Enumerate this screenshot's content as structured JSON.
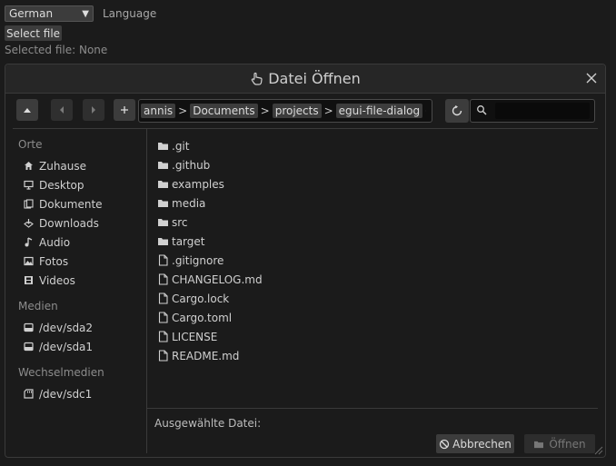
{
  "app": {
    "language_value": "German",
    "language_label": "Language",
    "select_file_label": "Select file",
    "selected_file_text": "Selected file: None"
  },
  "dialog": {
    "title": "Datei Öffnen",
    "path": [
      "annis",
      "Documents",
      "projects",
      "egui-file-dialog"
    ],
    "path_separator": ">",
    "search": {
      "value": "",
      "placeholder": ""
    },
    "sidebar": [
      {
        "heading": "Orte",
        "items": [
          {
            "label": "Zuhause",
            "icon": "home-icon"
          },
          {
            "label": "Desktop",
            "icon": "desktop-icon"
          },
          {
            "label": "Dokumente",
            "icon": "documents-icon"
          },
          {
            "label": "Downloads",
            "icon": "downloads-icon"
          },
          {
            "label": "Audio",
            "icon": "music-icon"
          },
          {
            "label": "Fotos",
            "icon": "image-icon"
          },
          {
            "label": "Videos",
            "icon": "film-icon"
          }
        ]
      },
      {
        "heading": "Medien",
        "items": [
          {
            "label": "/dev/sda2",
            "icon": "disk-icon"
          },
          {
            "label": "/dev/sda1",
            "icon": "disk-icon"
          }
        ]
      },
      {
        "heading": "Wechselmedien",
        "items": [
          {
            "label": "/dev/sdc1",
            "icon": "removable-drive-icon"
          }
        ]
      }
    ],
    "files": [
      {
        "name": ".git",
        "type": "folder"
      },
      {
        "name": ".github",
        "type": "folder"
      },
      {
        "name": "examples",
        "type": "folder"
      },
      {
        "name": "media",
        "type": "folder"
      },
      {
        "name": "src",
        "type": "folder"
      },
      {
        "name": "target",
        "type": "folder"
      },
      {
        "name": ".gitignore",
        "type": "file"
      },
      {
        "name": "CHANGELOG.md",
        "type": "file"
      },
      {
        "name": "Cargo.lock",
        "type": "file"
      },
      {
        "name": "Cargo.toml",
        "type": "file"
      },
      {
        "name": "LICENSE",
        "type": "file"
      },
      {
        "name": "README.md",
        "type": "file"
      }
    ],
    "selected_file_label": "Ausgewählte Datei:",
    "cancel_label": "Abbrechen",
    "open_label": "Öffnen"
  },
  "colors": {
    "background": "#1b1b1b",
    "panel": "#262626",
    "button": "#3c3c3c",
    "text": "#d0d0d0",
    "muted_text": "#8c8c8c"
  }
}
